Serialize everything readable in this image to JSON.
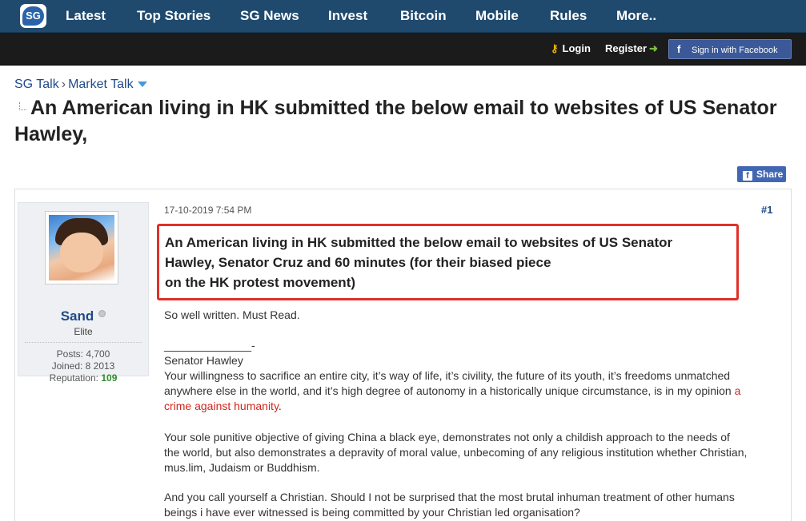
{
  "nav": {
    "logo_text": "SG",
    "links": [
      "Latest",
      "Top Stories",
      "SG News",
      "Invest",
      "Bitcoin",
      "Mobile",
      "Rules",
      "More.."
    ]
  },
  "subbar": {
    "login": "Login",
    "register": "Register",
    "facebook": "Sign in with Facebook"
  },
  "breadcrumb": {
    "items": [
      "SG Talk",
      "Market Talk"
    ]
  },
  "page_title": "An American living in HK submitted the below email to websites of US Senator Hawley,",
  "share_label": "Share",
  "post": {
    "date": "17-10-2019 7:54 PM",
    "number": "#1",
    "title_lines": [
      "An American living in HK submitted the below email to websites of US Senator",
      "Hawley, Senator Cruz and 60 minutes (for their biased piece",
      "on the HK protest movement)"
    ],
    "user": {
      "name": "Sand",
      "rank": "Elite",
      "posts": "Posts: 4,700",
      "joined": "Joined: 8 2013",
      "reputation_label": "Reputation:",
      "reputation_value": "109"
    },
    "intro": "So well written. Must Read.",
    "separator": "______________-",
    "salutation": "Senator Hawley",
    "p1_before": "Your willingness to sacrifice an entire city, it’s way of life, it’s civility, the future of its youth, it’s freedoms unmatched anywhere else in the world, and it’s high degree of autonomy in a historically unique circumstance, is in my opinion ",
    "p1_red": "a crime against humanity",
    "p1_after": ".",
    "p2": "Your sole punitive objective of giving China a black eye, demonstrates not only a childish approach to the needs of the world, but also demonstrates a depravity of moral value, unbecoming of any religious institution whether Christian, mus.lim, Judaism or Buddhism.",
    "p3": "And you call yourself a Christian. Should I not be surprised that the most brutal inhuman treatment of other humans beings i have ever witnessed is being committed by your Christian led organisation?"
  },
  "colors": {
    "nav_bg": "#1f4a6e",
    "subbar_bg": "#1b1b1b",
    "link_blue": "#1f4a87",
    "highlight_red": "#e0302a",
    "facebook_blue": "#3b5998"
  }
}
